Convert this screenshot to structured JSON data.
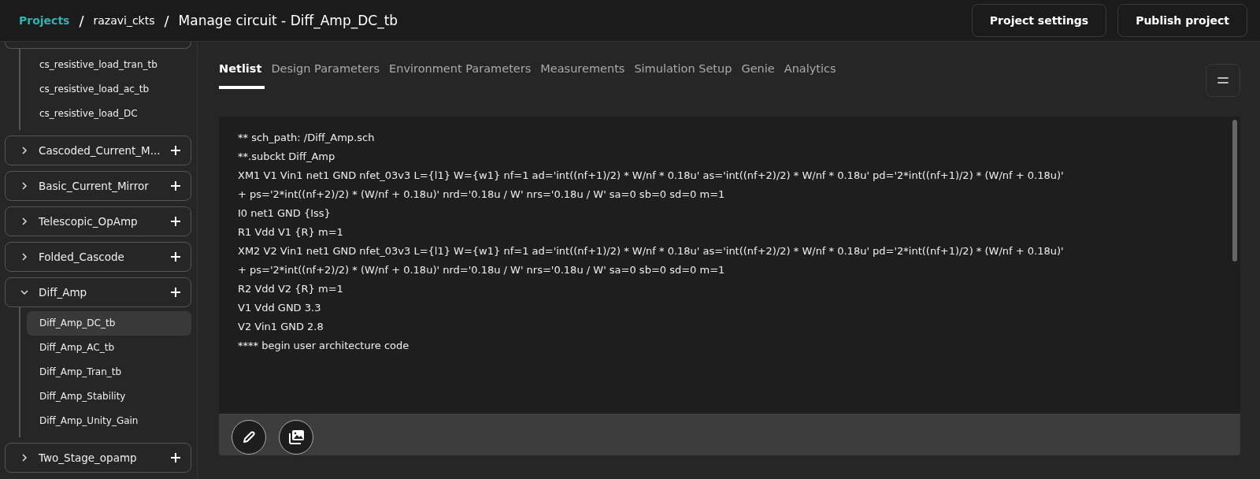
{
  "breadcrumb": [
    {
      "label": "Projects",
      "kind": "link"
    },
    {
      "label": "/",
      "kind": "separator"
    },
    {
      "label": "razavi_ckts",
      "kind": "text"
    },
    {
      "label": "/",
      "kind": "separator"
    },
    {
      "label": "Manage circuit - Diff_Amp_DC_tb",
      "kind": "title"
    }
  ],
  "header_buttons": [
    "Project settings",
    "Publish project"
  ],
  "sidebar": {
    "groups": [
      {
        "children": [
          {
            "label": "cs_resistive_load_tran_tb",
            "selected": false
          },
          {
            "label": "cs_resistive_load_ac_tb",
            "selected": false
          },
          {
            "label": "cs_resistive_load_DC",
            "selected": false
          }
        ]
      },
      {
        "label": "Cascoded_Current_M...",
        "expanded": false
      },
      {
        "label": "Basic_Current_Mirror",
        "expanded": false
      },
      {
        "label": "Telescopic_OpAmp",
        "expanded": false
      },
      {
        "label": "Folded_Cascode",
        "expanded": false
      },
      {
        "label": "Diff_Amp",
        "expanded": true,
        "children": [
          {
            "label": "Diff_Amp_DC_tb",
            "selected": true
          },
          {
            "label": "Diff_Amp_AC_tb",
            "selected": false
          },
          {
            "label": "Diff_Amp_Tran_tb",
            "selected": false
          },
          {
            "label": "Diff_Amp_Stability",
            "selected": false
          },
          {
            "label": "Diff_Amp_Unity_Gain",
            "selected": false
          }
        ]
      },
      {
        "label": "Two_Stage_opamp",
        "expanded": false
      }
    ]
  },
  "tabs": [
    {
      "label": "Netlist",
      "selected": true
    },
    {
      "label": "Design Parameters",
      "selected": false
    },
    {
      "label": "Environment Parameters",
      "selected": false
    },
    {
      "label": "Measurements",
      "selected": false
    },
    {
      "label": "Simulation Setup",
      "selected": false
    },
    {
      "label": "Genie",
      "selected": false
    },
    {
      "label": "Analytics",
      "selected": false
    }
  ],
  "netlist": {
    "lines": [
      "** sch_path: /Diff_Amp.sch",
      "**.subckt Diff_Amp",
      "XM1 V1 Vin1 net1 GND nfet_03v3 L={l1} W={w1} nf=1 ad='int((nf+1)/2) * W/nf * 0.18u' as='int((nf+2)/2) * W/nf * 0.18u' pd='2*int((nf+1)/2) * (W/nf + 0.18u)'",
      "+ ps='2*int((nf+2)/2) * (W/nf + 0.18u)' nrd='0.18u / W' nrs='0.18u / W' sa=0 sb=0 sd=0 m=1",
      "I0 net1 GND {Iss}",
      "R1 Vdd V1 {R} m=1",
      "XM2 V2 Vin1 net1 GND nfet_03v3 L={l1} W={w1} nf=1 ad='int((nf+1)/2) * W/nf * 0.18u' as='int((nf+2)/2) * W/nf * 0.18u' pd='2*int((nf+1)/2) * (W/nf + 0.18u)'",
      "+ ps='2*int((nf+2)/2) * (W/nf + 0.18u)' nrd='0.18u / W' nrs='0.18u / W' sa=0 sb=0 sd=0 m=1",
      "R2 Vdd V2 {R} m=1",
      "V1 Vdd GND 3.3",
      "V2 Vin1 GND 2.8",
      "**** begin user architecture code"
    ]
  }
}
